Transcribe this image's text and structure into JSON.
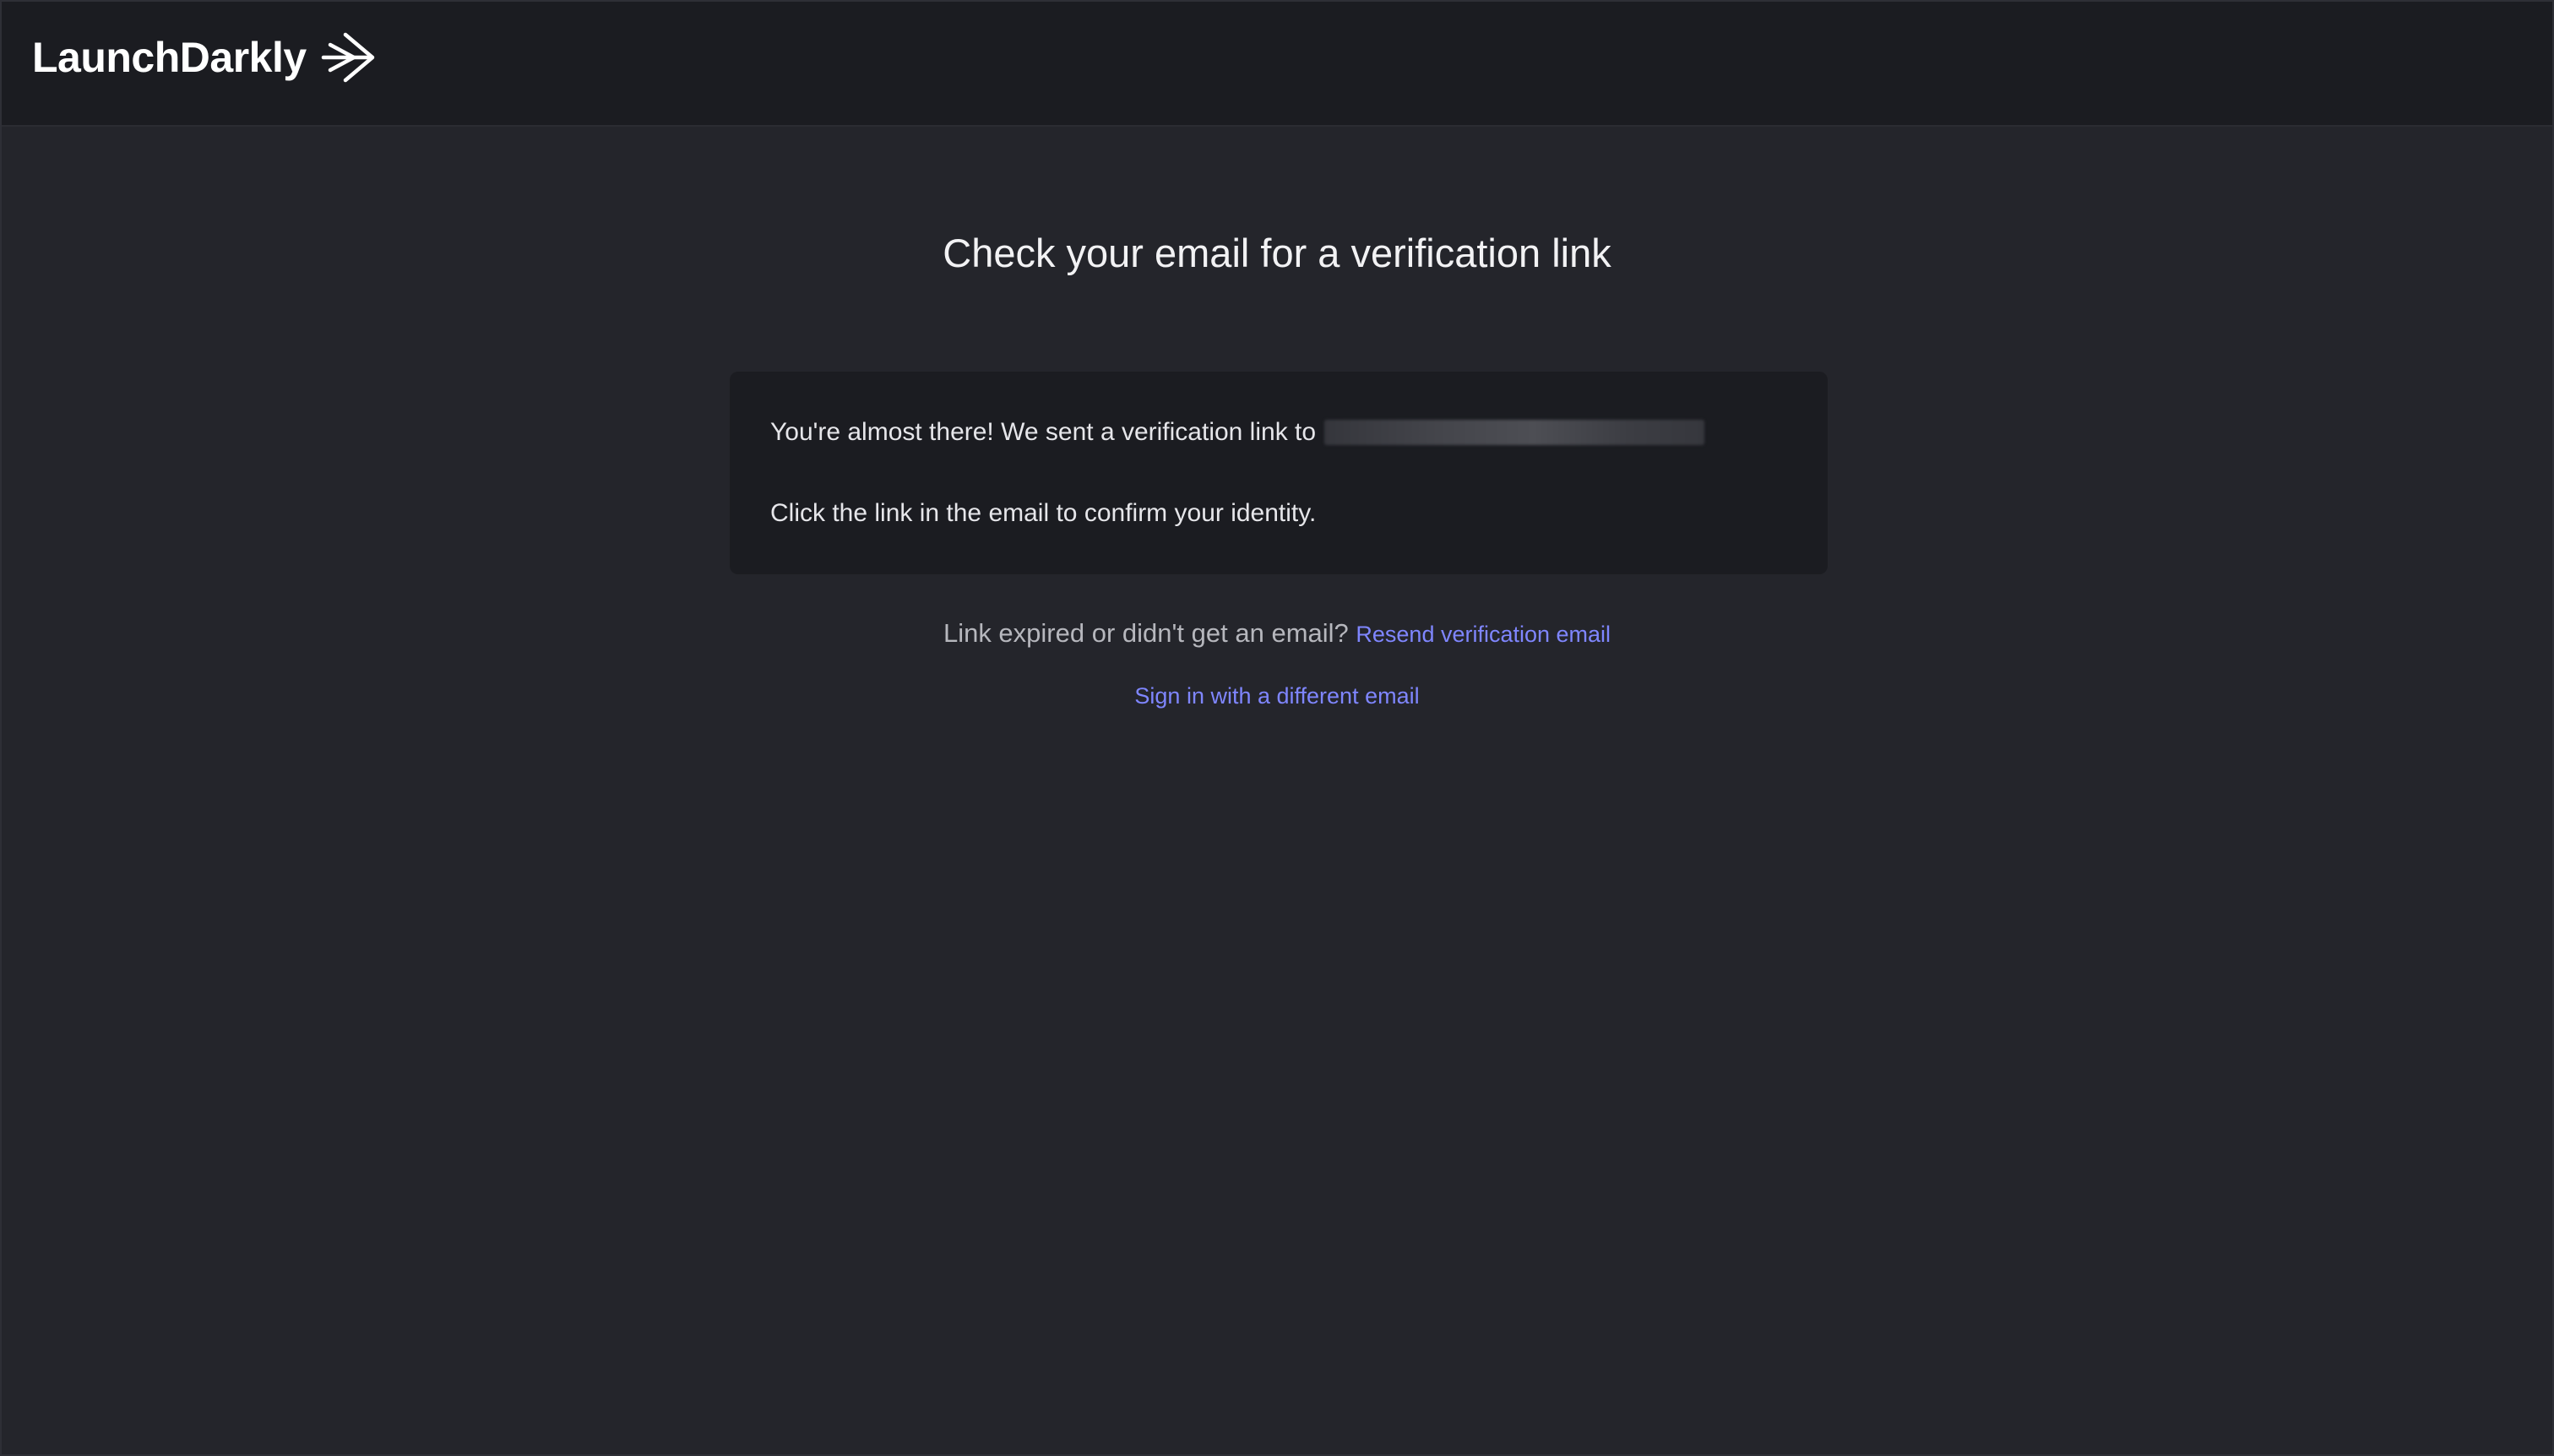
{
  "header": {
    "brand_name": "LaunchDarkly",
    "brand_icon": "launchdarkly-arrow-icon"
  },
  "main": {
    "title": "Check your email for a verification link",
    "card": {
      "line1": "You're almost there! We sent a verification link to",
      "email_redacted": "",
      "line2": "Click the link in the email to confirm your identity."
    },
    "resend_prompt": "Link expired or didn't get an email?",
    "resend_link": "Resend verification email",
    "different_email_link": "Sign in with a different email"
  },
  "colors": {
    "page_background": "#24252b",
    "header_background": "#1b1c21",
    "card_background": "#1b1c21",
    "link": "#7f86ff"
  }
}
